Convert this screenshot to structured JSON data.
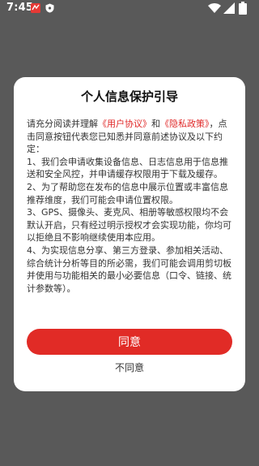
{
  "status_bar": {
    "time": "7:45",
    "icons": [
      "app-notification-icon",
      "shield-icon",
      "wifi-icon",
      "signal-icon",
      "battery-icon"
    ]
  },
  "dialog": {
    "title": "个人信息保护引导",
    "intro_prefix": "请充分阅读并理解",
    "user_agreement_link": "《用户协议》",
    "and": "和",
    "privacy_policy_link": "《隐私政策》",
    "intro_suffix": "，点击同意按钮代表您已知悉并同意前述协议及以下约定：",
    "items": [
      "1、我们会申请收集设备信息、日志信息用于信息推送和安全风控，并申请缓存权限用于下载及缓存。",
      "2、为了帮助您在发布的信息中展示位置或丰富信息推荐维度，我们可能会申请位置权限。",
      "3、GPS、摄像头、麦克风、相册等敏感权限均不会默认开启，只有经过明示授权才会实现功能，你均可以拒绝且不影响继续使用本应用。",
      "4、为实现信息分享、第三方登录、参加相关活动、综合统计分析等目的所必需，我们可能会调用剪切板并使用与功能相关的最小必要信息（口令、链接、统计参数等）。"
    ],
    "agree_label": "同意",
    "disagree_label": "不同意"
  },
  "colors": {
    "overlay": "#595959",
    "accent": "#e12b26",
    "link": "#e02828"
  }
}
